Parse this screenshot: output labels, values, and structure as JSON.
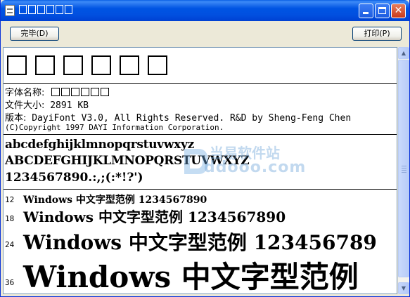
{
  "window": {
    "title_placeholder_count": 6
  },
  "toolbar": {
    "done_label": "完毕(D)",
    "print_label": "打印(P)"
  },
  "preview": {
    "glyph_box_count": 6,
    "font_name_label": "字体名称:",
    "file_size_label": "文件大小:",
    "file_size_value": "2891 KB",
    "version_label": "版本:",
    "version_value": "DayiFont V3.0, All Rights Reserved. R&D by Sheng-Feng Chen",
    "copyright": "(C)Copyright 1997 DAYI Information Corporation.",
    "lowercase": "abcdefghijklmnopqrstuvwxyz",
    "uppercase": "ABCDEFGHIJKLMNOPQRSTUVWXYZ",
    "digits": "1234567890.:,;(:*!?')",
    "sizes": [
      {
        "size": "12",
        "text": "Windows 中文字型范例 1234567890"
      },
      {
        "size": "18",
        "text": "Windows 中文字型范例 1234567890"
      },
      {
        "size": "24",
        "text": "Windows 中文字型范例 123456789"
      },
      {
        "size": "36",
        "text": "Windows 中文字型范例"
      }
    ]
  },
  "watermark": {
    "name": "当易软件站",
    "url": "ddooo.com"
  },
  "colors": {
    "titlebar": "#0054E3",
    "window_face": "#ECE9D8",
    "content_bg": "#FFFFFF"
  }
}
